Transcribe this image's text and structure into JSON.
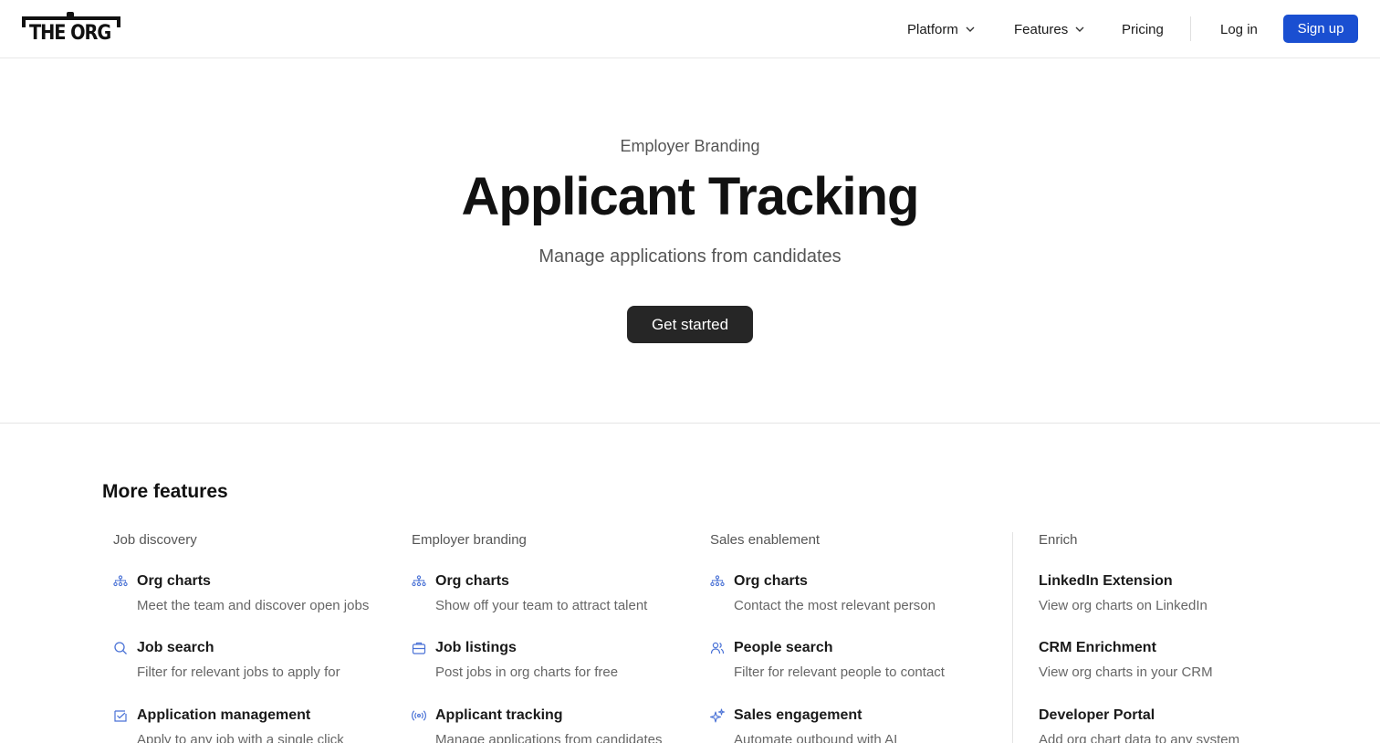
{
  "header": {
    "logo_text": "THE ORG",
    "nav": [
      {
        "label": "Platform",
        "has_menu": true
      },
      {
        "label": "Features",
        "has_menu": true
      },
      {
        "label": "Pricing",
        "has_menu": false
      }
    ],
    "login_label": "Log in",
    "signup_label": "Sign up"
  },
  "hero": {
    "eyebrow": "Employer Branding",
    "title": "Applicant Tracking",
    "subtitle": "Manage applications from candidates",
    "cta_label": "Get started"
  },
  "more_features": {
    "title": "More features",
    "columns": [
      {
        "heading": "Job discovery",
        "items": [
          {
            "icon": "org-chart-icon",
            "title": "Org charts",
            "desc": "Meet the team and discover open jobs"
          },
          {
            "icon": "search-icon",
            "title": "Job search",
            "desc": "Filter for relevant jobs to apply for"
          },
          {
            "icon": "application-icon",
            "title": "Application management",
            "desc": "Apply to any job with a single click"
          }
        ]
      },
      {
        "heading": "Employer branding",
        "items": [
          {
            "icon": "org-chart-icon",
            "title": "Org charts",
            "desc": "Show off your team to attract talent"
          },
          {
            "icon": "briefcase-icon",
            "title": "Job listings",
            "desc": "Post jobs in org charts for free"
          },
          {
            "icon": "broadcast-icon",
            "title": "Applicant tracking",
            "desc": "Manage applications from candidates"
          }
        ]
      },
      {
        "heading": "Sales enablement",
        "items": [
          {
            "icon": "org-chart-icon",
            "title": "Org charts",
            "desc": "Contact the most relevant person"
          },
          {
            "icon": "people-icon",
            "title": "People search",
            "desc": "Filter for relevant people to contact"
          },
          {
            "icon": "sparkle-icon",
            "title": "Sales engagement",
            "desc": "Automate outbound with AI"
          }
        ]
      },
      {
        "heading": "Enrich",
        "items": [
          {
            "title": "LinkedIn Extension",
            "desc": "View org charts on LinkedIn"
          },
          {
            "title": "CRM Enrichment",
            "desc": "View org charts in your CRM"
          },
          {
            "title": "Developer Portal",
            "desc": "Add org chart data to any system"
          }
        ]
      }
    ]
  },
  "colors": {
    "accent": "#1a4fd1",
    "icon": "#4a72d6",
    "cta_bg": "#262626"
  }
}
